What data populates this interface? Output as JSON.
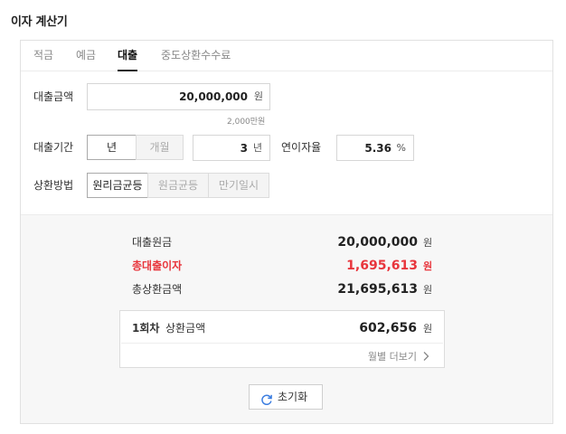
{
  "header": {
    "title": "이자 계산기"
  },
  "tabs": [
    {
      "label": "적금"
    },
    {
      "label": "예금"
    },
    {
      "label": "대출"
    },
    {
      "label": "중도상환수수료"
    }
  ],
  "form": {
    "loan_amount": {
      "label": "대출금액",
      "value": "20,000,000",
      "unit": "원",
      "hint": "2,000만원"
    },
    "period": {
      "label": "대출기간",
      "unit_year": "년",
      "unit_month": "개월",
      "value": "3",
      "value_unit": "년"
    },
    "rate": {
      "label": "연이자율",
      "value": "5.36",
      "unit": "%"
    },
    "method": {
      "label": "상환방법",
      "options": [
        "원리금균등",
        "원금균등",
        "만기일시"
      ]
    }
  },
  "result": {
    "principal": {
      "label": "대출원금",
      "value": "20,000,000",
      "unit": "원"
    },
    "interest": {
      "label": "총대출이자",
      "value": "1,695,613",
      "unit": "원"
    },
    "total": {
      "label": "총상환금액",
      "value": "21,695,613",
      "unit": "원"
    },
    "monthly": {
      "label_strong": "1회차",
      "label_rest": "상환금액",
      "value": "602,656",
      "unit": "원",
      "more": "월별 더보기"
    },
    "reset_label": "초기화"
  },
  "colors": {
    "accent_red": "#e8353c",
    "text": "#222222",
    "result_bg": "#f7f7f7"
  }
}
